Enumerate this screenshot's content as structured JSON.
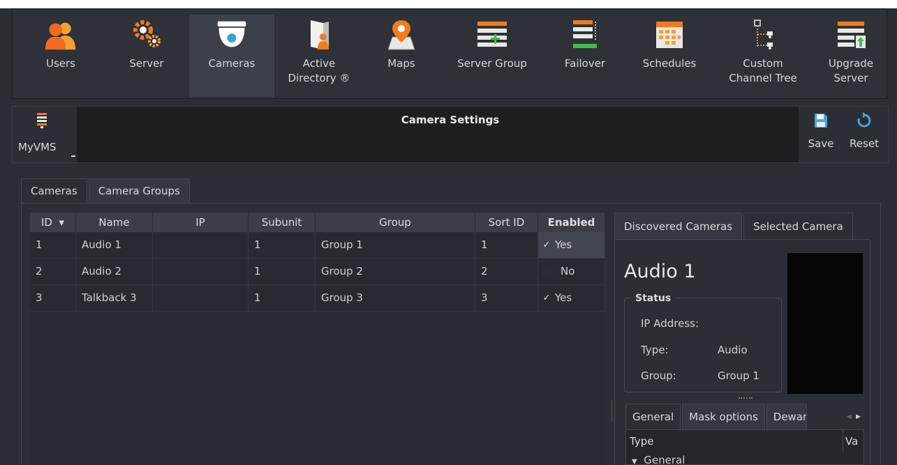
{
  "toolbar": {
    "items": [
      {
        "label": "Users",
        "icon": "users-icon"
      },
      {
        "label": "Server",
        "icon": "server-gears-icon"
      },
      {
        "label": "Cameras",
        "icon": "dome-camera-icon"
      },
      {
        "label": "Active\nDirectory ®",
        "icon": "active-directory-icon"
      },
      {
        "label": "Maps",
        "icon": "map-pin-icon"
      },
      {
        "label": "Server Group",
        "icon": "server-group-icon"
      },
      {
        "label": "Failover",
        "icon": "failover-icon"
      },
      {
        "label": "Schedules",
        "icon": "calendar-grid-icon"
      },
      {
        "label": "Custom\nChannel Tree",
        "icon": "channel-tree-icon"
      },
      {
        "label": "Upgrade\nServer",
        "icon": "upgrade-server-icon"
      }
    ],
    "active": "Cameras"
  },
  "header": {
    "title": "Camera Settings",
    "server_label": "MyVMS",
    "save_label": "Save",
    "reset_label": "Reset"
  },
  "tabs": [
    "Cameras",
    "Camera Groups"
  ],
  "table": {
    "columns": [
      "ID",
      "Name",
      "IP",
      "Subunit",
      "Group",
      "Sort ID",
      "Enabled"
    ],
    "sort_indicator": "▾",
    "rows": [
      {
        "id": "1",
        "name": "Audio 1",
        "ip": "",
        "subunit": "1",
        "group": "Group 1",
        "sort_id": "1",
        "enabled": "Yes",
        "checked": true
      },
      {
        "id": "2",
        "name": "Audio 2",
        "ip": "",
        "subunit": "1",
        "group": "Group 2",
        "sort_id": "2",
        "enabled": "No",
        "checked": false
      },
      {
        "id": "3",
        "name": "Talkback 3",
        "ip": "",
        "subunit": "1",
        "group": "Group 3",
        "sort_id": "3",
        "enabled": "Yes",
        "checked": true
      }
    ]
  },
  "right_panel": {
    "tabs": [
      "Discovered Cameras",
      "Selected Camera"
    ],
    "camera_name": "Audio 1",
    "status_title": "Status",
    "fields": {
      "ip_label": "IP Address:",
      "ip_value": "",
      "type_label": "Type:",
      "type_value": "Audio",
      "group_label": "Group:",
      "group_value": "Group 1"
    },
    "bottom_tabs": [
      "General",
      "Mask options",
      "Dewar"
    ],
    "prop_header_type": "Type",
    "prop_header_value": "Va",
    "prop_row": "General"
  },
  "colors": {
    "accent_orange": "#f07c1e",
    "icon_blue": "#4aa3df",
    "background": "#2b2e34"
  }
}
